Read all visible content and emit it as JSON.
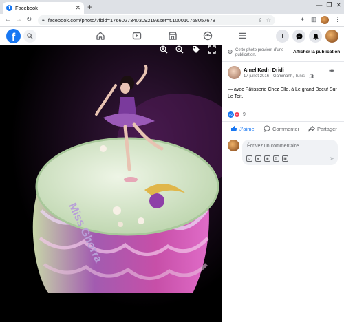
{
  "browser": {
    "tab_title": "Facebook",
    "tab_close": "✕",
    "new_tab": "+",
    "url": "facebook.com/photo/?fbid=1766027340309219&set=t.100010768057678",
    "window_controls": [
      "—",
      "❐",
      "✕"
    ]
  },
  "photo": {
    "cake_text": "Miss Ghorra",
    "background": "#000000"
  },
  "panel": {
    "notice_text": "Cette photo provient d’une publication.",
    "notice_button": "Afficher la publication",
    "author": "Amel Kadri Dridi",
    "date": "17 juillet 2016",
    "location": "Gammarth, Tunis",
    "privacy_icon": "friends-icon",
    "more": "•••",
    "post_text": "— avec Pâtisserie Chez Elle. à Le grand Boeuf Sur Le Toit.",
    "reaction_count": "9",
    "like_label": "J’aime",
    "comment_label": "Commenter",
    "share_label": "Partager",
    "comment_placeholder": "Écrivez un commentaire…",
    "comment_icons": [
      "emoji-icon",
      "camera-icon",
      "gif-icon",
      "sticker-icon"
    ]
  },
  "colors": {
    "brand": "#1877f2",
    "love": "#f33e58",
    "secondary_text": "#65676b"
  }
}
